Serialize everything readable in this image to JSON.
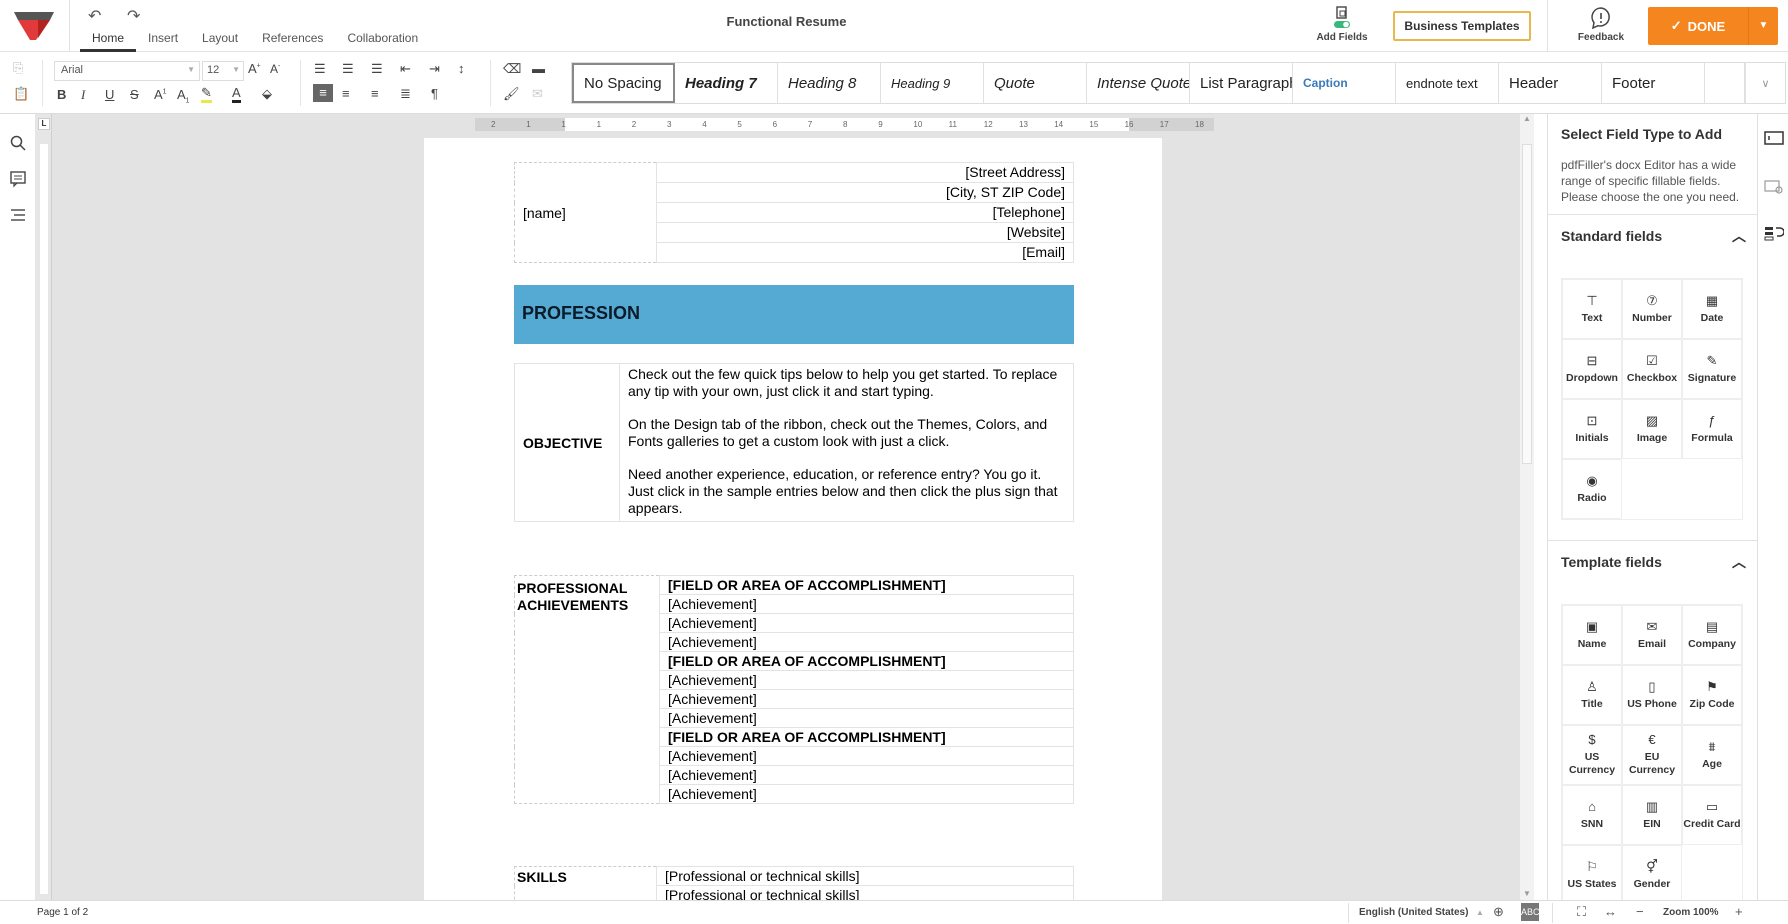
{
  "app": {
    "doc_title": "Functional Resume",
    "undo_icon": "undo-icon",
    "redo_icon": "redo-icon"
  },
  "tabs": [
    {
      "label": "Home",
      "active": true
    },
    {
      "label": "Insert"
    },
    {
      "label": "Layout"
    },
    {
      "label": "References"
    },
    {
      "label": "Collaboration"
    }
  ],
  "header_actions": {
    "add_fields": "Add Fields",
    "business_templates": "Business Templates",
    "feedback": "Feedback",
    "done": "DONE"
  },
  "toolbar": {
    "font": "Arial",
    "size": "12",
    "styles": [
      "No Spacing",
      "Heading 7",
      "Heading 8",
      "Heading 9",
      "Quote",
      "Intense Quote",
      "List Paragraph",
      "Caption",
      "endnote text",
      "Header",
      "Footer"
    ],
    "selected_style": "No Spacing",
    "accent_color": "#f5861f"
  },
  "ruler": {
    "numbers": [
      "2",
      "1",
      "1",
      "1",
      "2",
      "3",
      "4",
      "5",
      "6",
      "7",
      "8",
      "9",
      "10",
      "11",
      "12",
      "13",
      "14",
      "15",
      "16",
      "17",
      "18"
    ]
  },
  "document": {
    "name": "[name]",
    "contact": [
      "[Street Address]",
      "[City, ST ZIP Code]",
      "[Telephone]",
      "[Website]",
      "[Email]"
    ],
    "profession": "PROFESSION",
    "profession_color": "#55aad3",
    "objective_label": "OBJECTIVE",
    "objective_paragraphs": [
      "Check out the few quick tips below to help you get started. To replace any tip with your own, just click it and start typing.",
      "On the Design tab of the ribbon, check out the Themes, Colors, and Fonts galleries to get a custom look with just a click.",
      "Need another experience, education, or reference entry? You go it. Just click in the sample entries below and then click the plus sign that appears."
    ],
    "achievements_label_1": "PROFESSIONAL",
    "achievements_label_2": "ACHIEVEMENTS",
    "achievements": [
      {
        "text": "[FIELD OR AREA OF ACCOMPLISHMENT]",
        "bold": true
      },
      {
        "text": "[Achievement]"
      },
      {
        "text": "[Achievement]"
      },
      {
        "text": "[Achievement]"
      },
      {
        "text": "[FIELD OR AREA OF ACCOMPLISHMENT]",
        "bold": true
      },
      {
        "text": "[Achievement]"
      },
      {
        "text": "[Achievement]"
      },
      {
        "text": "[Achievement]"
      },
      {
        "text": "[FIELD OR AREA OF ACCOMPLISHMENT]",
        "bold": true
      },
      {
        "text": "[Achievement]"
      },
      {
        "text": "[Achievement]"
      },
      {
        "text": "[Achievement]"
      }
    ],
    "skills_label": "SKILLS",
    "skills": [
      "[Professional or technical skills]",
      "[Professional or technical skills]"
    ]
  },
  "panel": {
    "title": "Select Field Type to Add",
    "description": "pdfFiller's docx Editor has a wide range of specific fillable fields. Please choose the one you need.",
    "standard_heading": "Standard fields",
    "standard_fields": [
      {
        "label": "Text",
        "icon": "text-field-icon",
        "glyph": "⊤"
      },
      {
        "label": "Number",
        "icon": "number-field-icon",
        "glyph": "⑦"
      },
      {
        "label": "Date",
        "icon": "calendar-icon",
        "glyph": "▦"
      },
      {
        "label": "Dropdown",
        "icon": "dropdown-icon",
        "glyph": "⊟"
      },
      {
        "label": "Checkbox",
        "icon": "checkbox-icon",
        "glyph": "☑"
      },
      {
        "label": "Signature",
        "icon": "signature-icon",
        "glyph": "✎"
      },
      {
        "label": "Initials",
        "icon": "initials-icon",
        "glyph": "⊡"
      },
      {
        "label": "Image",
        "icon": "image-icon",
        "glyph": "▨"
      },
      {
        "label": "Formula",
        "icon": "formula-icon",
        "glyph": "ƒ"
      },
      {
        "label": "Radio",
        "icon": "radio-icon",
        "glyph": "◉"
      }
    ],
    "template_heading": "Template fields",
    "template_fields": [
      {
        "label": "Name",
        "icon": "name-icon",
        "glyph": "▣"
      },
      {
        "label": "Email",
        "icon": "email-icon",
        "glyph": "✉"
      },
      {
        "label": "Company",
        "icon": "company-icon",
        "glyph": "▤"
      },
      {
        "label": "Title",
        "icon": "title-icon",
        "glyph": "♙"
      },
      {
        "label": "US Phone",
        "icon": "phone-icon",
        "glyph": "▯"
      },
      {
        "label": "Zip Code",
        "icon": "mailbox-icon",
        "glyph": "⚑"
      },
      {
        "label": "US Currency",
        "icon": "dollar-icon",
        "glyph": "$"
      },
      {
        "label": "EU Currency",
        "icon": "euro-icon",
        "glyph": "€"
      },
      {
        "label": "Age",
        "icon": "cake-icon",
        "glyph": "⩩"
      },
      {
        "label": "SNN",
        "icon": "bank-icon",
        "glyph": "⌂"
      },
      {
        "label": "EIN",
        "icon": "ein-icon",
        "glyph": "▥"
      },
      {
        "label": "Credit Card",
        "icon": "credit-card-icon",
        "glyph": "▭"
      },
      {
        "label": "US States",
        "icon": "flag-icon",
        "glyph": "⚐"
      },
      {
        "label": "Gender",
        "icon": "gender-icon",
        "glyph": "⚥"
      }
    ]
  },
  "status": {
    "page": "Page 1 of 2",
    "language": "English (United States)",
    "zoom": "Zoom 100%"
  }
}
